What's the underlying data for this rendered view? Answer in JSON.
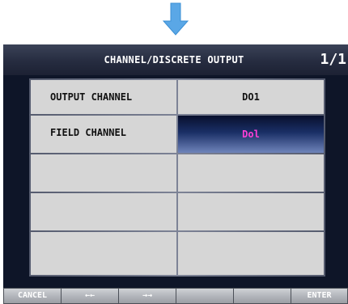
{
  "window": {
    "title": "CHANNEL/DISCRETE OUTPUT",
    "page": "1/1"
  },
  "table": {
    "rows": [
      {
        "label": "OUTPUT CHANNEL",
        "value": "DO1"
      },
      {
        "label": "FIELD CHANNEL",
        "value": "Dol"
      },
      {
        "label": "",
        "value": ""
      },
      {
        "label": "",
        "value": ""
      },
      {
        "label": "",
        "value": ""
      }
    ]
  },
  "softkeys": {
    "cancel": "CANCEL",
    "prev": "←←",
    "next": "→→",
    "enter": "ENTER"
  },
  "colors": {
    "arrow": "#5aa7e6",
    "selected_text": "#ff3fd7",
    "cell": "#d6d6d6"
  }
}
